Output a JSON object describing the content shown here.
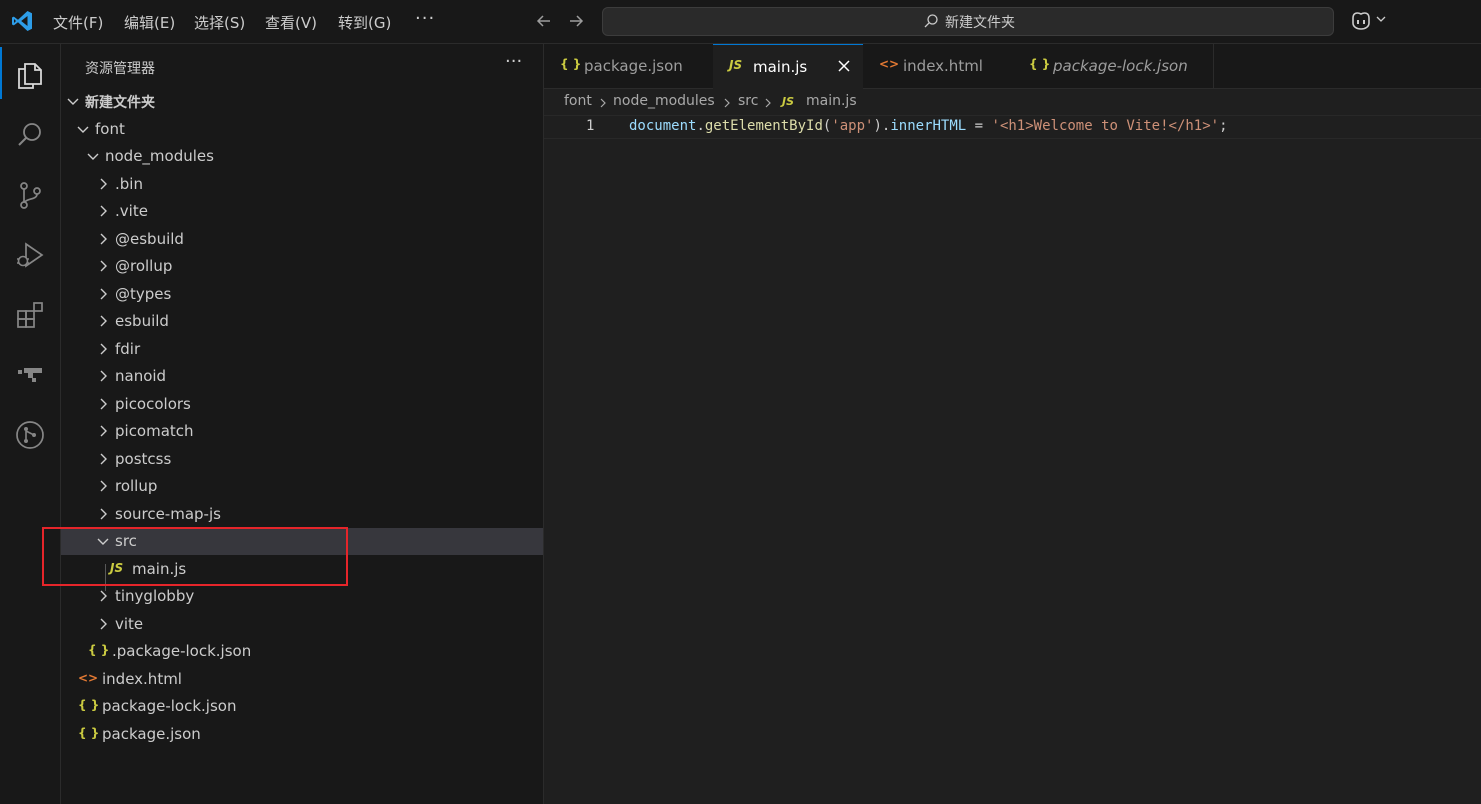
{
  "menu": {
    "file": "文件(F)",
    "edit": "编辑(E)",
    "selection": "选择(S)",
    "view": "查看(V)",
    "go": "转到(G)",
    "more": "···"
  },
  "search": {
    "text": "新建文件夹"
  },
  "sidebar": {
    "title": "资源管理器",
    "more": "···",
    "tree": [
      {
        "label": "新建文件夹",
        "type": "folder",
        "expanded": true
      },
      {
        "label": "font",
        "type": "folder",
        "expanded": true
      },
      {
        "label": "node_modules",
        "type": "folder",
        "expanded": true
      },
      {
        "label": ".bin",
        "type": "folder",
        "expanded": false
      },
      {
        "label": ".vite",
        "type": "folder",
        "expanded": false
      },
      {
        "label": "@esbuild",
        "type": "folder",
        "expanded": false
      },
      {
        "label": "@rollup",
        "type": "folder",
        "expanded": false
      },
      {
        "label": "@types",
        "type": "folder",
        "expanded": false
      },
      {
        "label": "esbuild",
        "type": "folder",
        "expanded": false
      },
      {
        "label": "fdir",
        "type": "folder",
        "expanded": false
      },
      {
        "label": "nanoid",
        "type": "folder",
        "expanded": false
      },
      {
        "label": "picocolors",
        "type": "folder",
        "expanded": false
      },
      {
        "label": "picomatch",
        "type": "folder",
        "expanded": false
      },
      {
        "label": "postcss",
        "type": "folder",
        "expanded": false
      },
      {
        "label": "rollup",
        "type": "folder",
        "expanded": false
      },
      {
        "label": "source-map-js",
        "type": "folder",
        "expanded": false
      },
      {
        "label": "src",
        "type": "folder",
        "expanded": true
      },
      {
        "label": "main.js",
        "type": "js"
      },
      {
        "label": "tinyglobby",
        "type": "folder",
        "expanded": false
      },
      {
        "label": "vite",
        "type": "folder",
        "expanded": false
      },
      {
        "label": ".package-lock.json",
        "type": "json"
      },
      {
        "label": "index.html",
        "type": "html"
      },
      {
        "label": "package-lock.json",
        "type": "json"
      },
      {
        "label": "package.json",
        "type": "json"
      }
    ]
  },
  "icons": {
    "json": "{ }",
    "js": "JS",
    "html": "<>"
  },
  "tabs": [
    {
      "label": "package.json",
      "icon": "json",
      "active": false
    },
    {
      "label": "main.js",
      "icon": "js",
      "active": true
    },
    {
      "label": "index.html",
      "icon": "html",
      "active": false
    },
    {
      "label": "package-lock.json",
      "icon": "json",
      "active": false
    }
  ],
  "breadcrumb": [
    "font",
    "node_modules",
    "src",
    "main.js"
  ],
  "editor": {
    "line_number": "1",
    "tokens": {
      "obj": "document",
      "dot1": ".",
      "fn": "getElementById",
      "open": "(",
      "arg": "'app'",
      "close": ")",
      "dot2": ".",
      "prop": "innerHTML",
      "eq": " = ",
      "str": "'<h1>Welcome to Vite!</h1>'",
      "semi": ";"
    }
  },
  "colors": {
    "accent": "#0078d4",
    "highlight_box": "#e5252a",
    "json_icon": "#cbcb41",
    "html_icon": "#e37933"
  }
}
